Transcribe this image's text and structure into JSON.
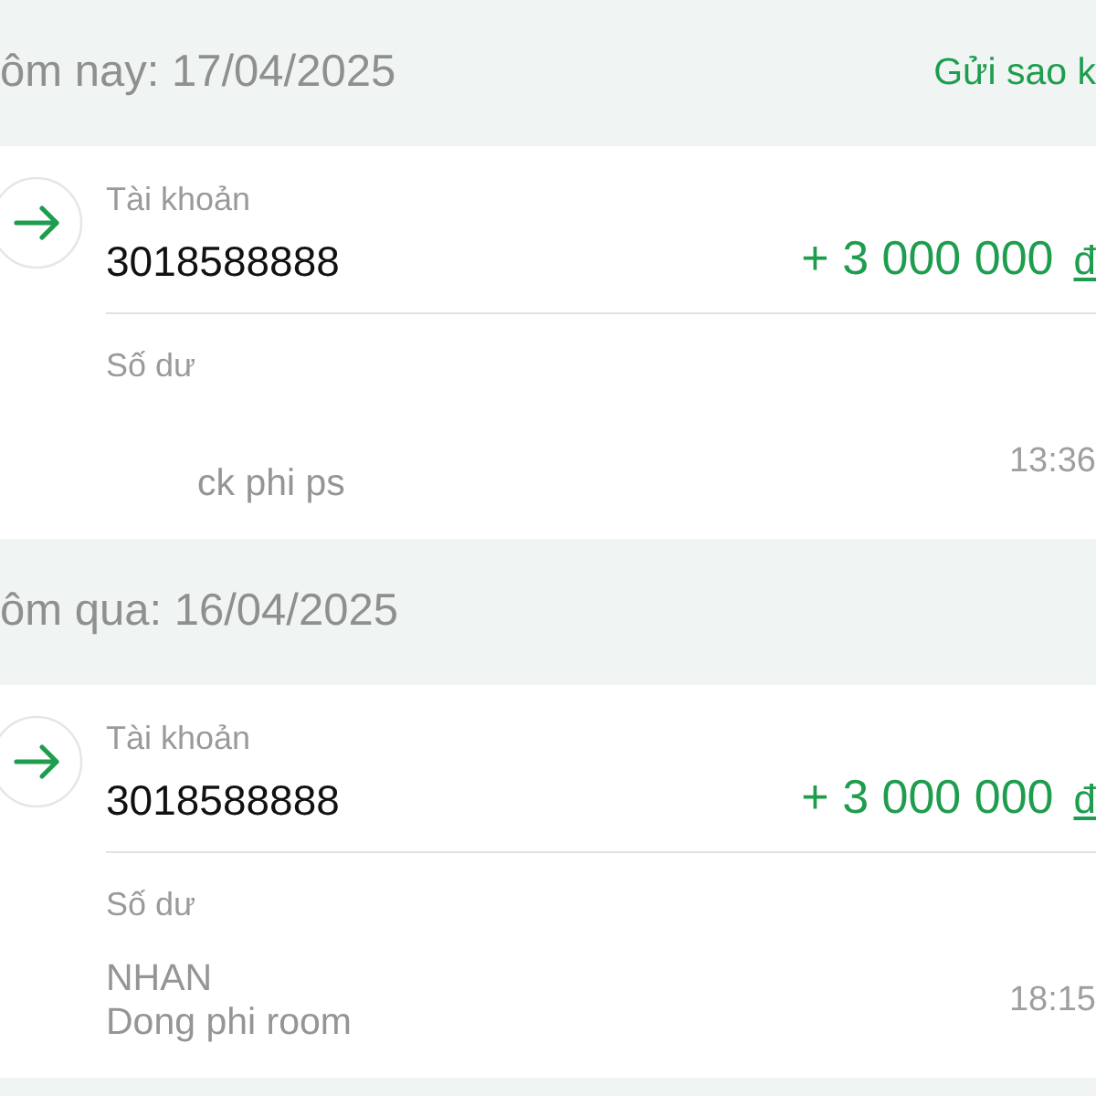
{
  "sections": [
    {
      "date_label": "ôm nay: 17/04/2025",
      "action": "Gửi sao k",
      "transactions": [
        {
          "kind": "incoming",
          "account_label": "Tài khoản",
          "account": "3018588888",
          "amount": "+ 3 000 000",
          "currency": "đ",
          "balance_label": "Số dư",
          "description_lines": [
            {
              "text": "ck phi ps",
              "indented": true
            }
          ],
          "time": "13:36"
        }
      ]
    },
    {
      "date_label": "ôm qua: 16/04/2025",
      "transactions": [
        {
          "kind": "incoming",
          "account_label": "Tài khoản",
          "account": "3018588888",
          "amount": "+ 3 000 000",
          "currency": "đ",
          "balance_label": "Số dư",
          "description_lines": [
            {
              "text": "NHAN",
              "indented": false
            },
            {
              "text": "Dong phi room",
              "indented": false
            }
          ],
          "time": "18:15"
        }
      ]
    }
  ]
}
